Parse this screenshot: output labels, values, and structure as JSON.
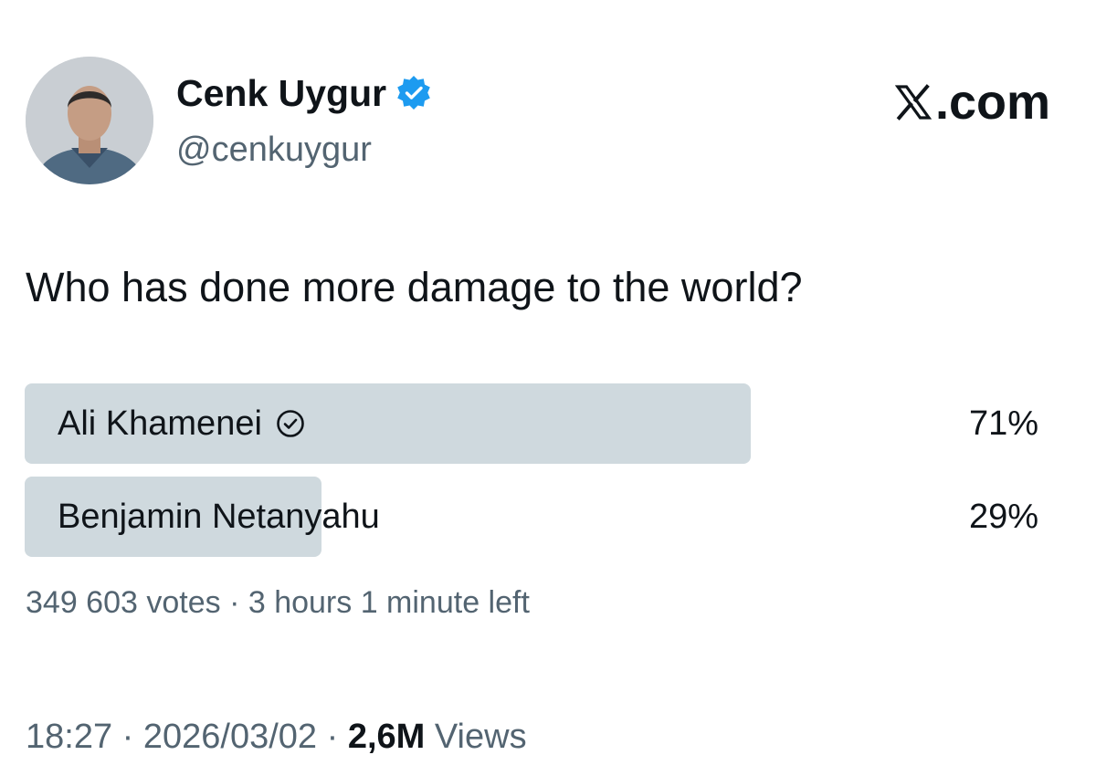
{
  "author": {
    "display_name": "Cenk Uygur",
    "handle": "@cenkuygur",
    "verified_icon": "verified-badge-icon",
    "badge_color": "#1d9bf0"
  },
  "branding": {
    "site_label": ".com",
    "logo": "x-logo-icon"
  },
  "tweet": {
    "text": "Who has done more damage to the world?"
  },
  "poll": {
    "options": [
      {
        "label": "Ali Khamenei",
        "percent_text": "71%",
        "percent": 71,
        "winner": true
      },
      {
        "label": "Benjamin Netanyahu",
        "percent_text": "29%",
        "percent": 29,
        "winner": false
      }
    ],
    "votes": "349 603 votes",
    "separator": " · ",
    "time_left": "3 hours 1 minute left",
    "bar_color": "#cfd9de"
  },
  "footer": {
    "time": "18:27",
    "date": "2026/03/02",
    "views_count": "2,6M",
    "views_label": " Views",
    "separator": " · "
  }
}
